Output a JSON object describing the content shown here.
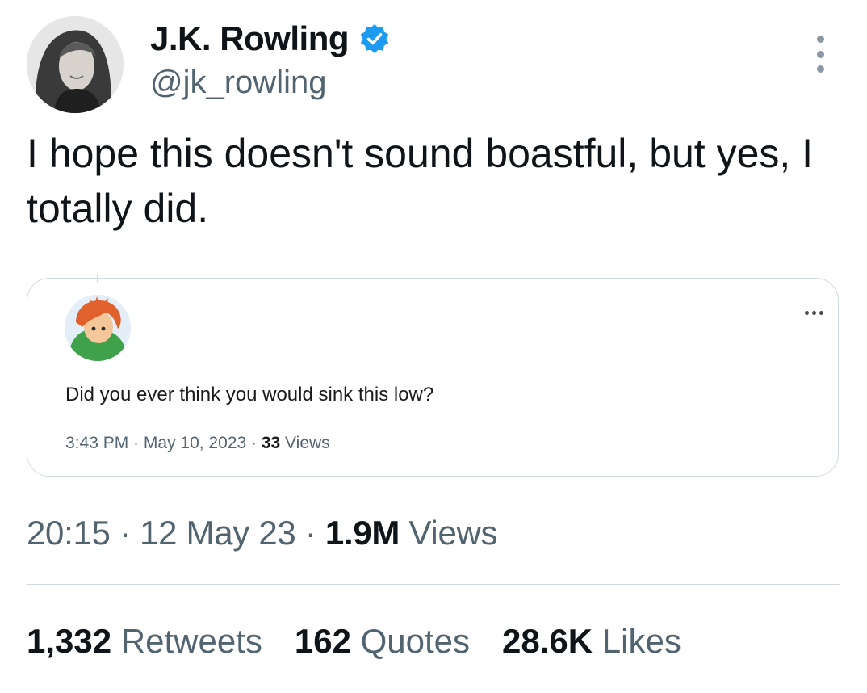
{
  "author": {
    "name": "J.K. Rowling",
    "handle": "@jk_rowling",
    "verified_color": "#1d9bf0"
  },
  "tweet": {
    "text": "I hope this doesn't sound boastful, but yes, I totally did."
  },
  "quoted": {
    "text": "Did you ever think you would sink this low?",
    "time": "3:43 PM",
    "sep1": " · ",
    "date": "May 10, 2023",
    "sep2": " · ",
    "views_count": "33",
    "views_label": " Views"
  },
  "meta": {
    "time": "20:15",
    "sep1": " · ",
    "date": "12 May 23",
    "sep2": " · ",
    "views_count": "1.9M",
    "views_label": " Views"
  },
  "stats": {
    "retweets_count": "1,332",
    "retweets_label": " Retweets",
    "quotes_count": "162",
    "quotes_label": " Quotes",
    "likes_count": "28.6K",
    "likes_label": " Likes"
  },
  "icons": {
    "menu": "more-vertical-icon",
    "quote_menu": "more-horizontal-icon",
    "badge": "verified-badge-icon"
  }
}
